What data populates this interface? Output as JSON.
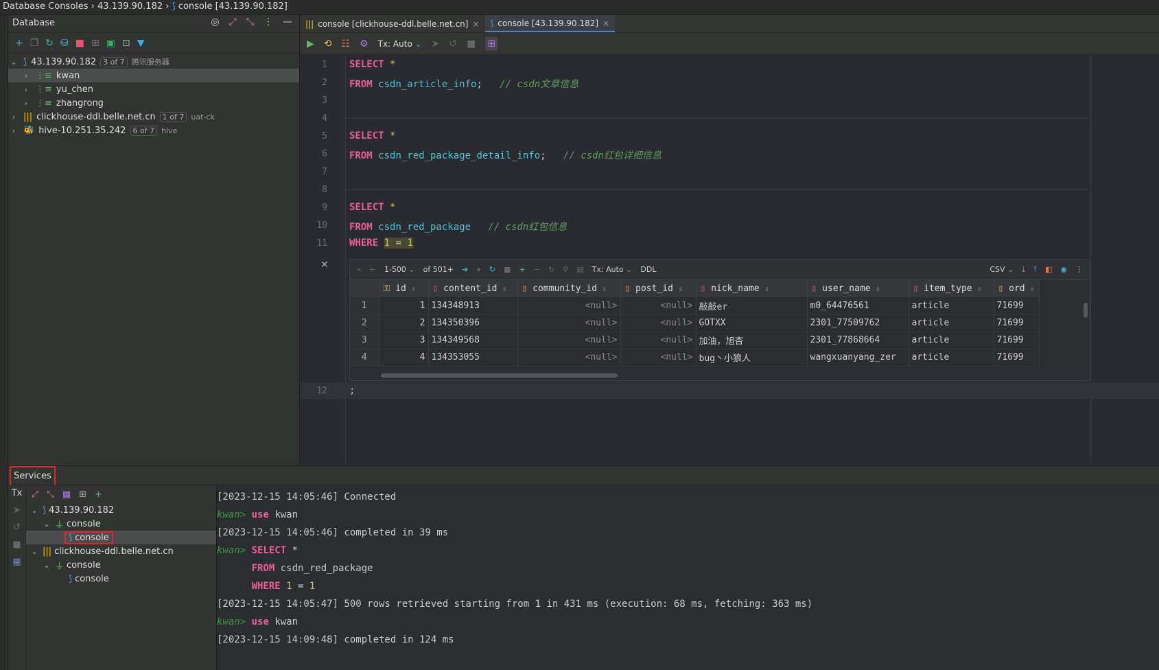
{
  "titlebar": {
    "crumbs": [
      "Database Consoles",
      "43.139.90.182",
      "console [43.139.90.182]"
    ]
  },
  "db_panel": {
    "title": "Database",
    "tree": [
      {
        "label": "43.139.90.182",
        "badge": "3 of 7",
        "hint": "腾讯服务器",
        "children": [
          "kwan",
          "yu_chen",
          "zhangrong"
        ]
      },
      {
        "label": "clickhouse-ddl.belle.net.cn",
        "badge": "1 of 7",
        "hint": "uat-ck"
      },
      {
        "label": "hive-10.251.35.242",
        "badge": "6 of 7",
        "hint": "hive"
      }
    ]
  },
  "editor": {
    "tabs": [
      {
        "label": "console [clickhouse-ddl.belle.net.cn]"
      },
      {
        "label": "console [43.139.90.182]",
        "active": true
      }
    ],
    "toolbar": {
      "tx": "Tx: Auto"
    },
    "lines": [
      {
        "n": "1",
        "kw": "SELECT",
        "rest": " *"
      },
      {
        "n": "2",
        "kw": "FROM",
        "table": "csdn_article_info",
        "semi": ";",
        "comment": "// csdn文章信息"
      },
      {
        "n": "3"
      },
      {
        "n": "4"
      },
      {
        "n": "5",
        "kw": "SELECT",
        "rest": " *"
      },
      {
        "n": "6",
        "kw": "FROM",
        "table": "csdn_red_package_detail_info",
        "semi": ";",
        "comment": "// csdn红包详细信息"
      },
      {
        "n": "7"
      },
      {
        "n": "8"
      },
      {
        "n": "9",
        "kw": "SELECT",
        "rest": " *"
      },
      {
        "n": "10",
        "kw": "FROM",
        "table": "csdn_red_package",
        "semi": "",
        "comment": "// csdn红包信息"
      },
      {
        "n": "11",
        "kw": "WHERE",
        "a": "1",
        "op": " = ",
        "b": "1"
      },
      {
        "n": "12",
        "rest": ";"
      }
    ]
  },
  "grid": {
    "toolbar": {
      "range": "1-500",
      "of": "of 501+",
      "tx": "Tx: Auto",
      "ddl": "DDL",
      "export": "CSV"
    },
    "columns": [
      "id",
      "content_id",
      "community_id",
      "post_id",
      "nick_name",
      "user_name",
      "item_type",
      "ord"
    ],
    "rows": [
      [
        "1",
        "1",
        "134348913",
        "<null>",
        "<null>",
        "敲敲er",
        "m0_64476561",
        "article",
        "71699"
      ],
      [
        "2",
        "2",
        "134350396",
        "<null>",
        "<null>",
        "GOTXX",
        "2301_77509762",
        "article",
        "71699"
      ],
      [
        "3",
        "3",
        "134349568",
        "<null>",
        "<null>",
        "加油，旭杏",
        "2301_77868664",
        "article",
        "71699"
      ],
      [
        "4",
        "4",
        "134353055",
        "<null>",
        "<null>",
        "bug丶小狼人",
        "wangxuanyang_zer",
        "article",
        "71699"
      ]
    ]
  },
  "services": {
    "title": "Services",
    "tx": "Tx",
    "tree": [
      {
        "label": "43.139.90.182",
        "child": "console",
        "leaf": "console"
      },
      {
        "label": "clickhouse-ddl.belle.net.cn",
        "child": "console",
        "leaf": "console"
      }
    ],
    "output": {
      "l1": "[2023-12-15 14:05:46] Connected",
      "prompt": "kwan>",
      "use": "use",
      "db": "kwan",
      "l3": "[2023-12-15 14:05:46] completed in 39 ms",
      "sel": "SELECT",
      "star": "*",
      "from": "FROM",
      "tbl": "csdn_red_package",
      "where": "WHERE",
      "one": "1",
      "eq": "=",
      "l7": "[2023-12-15 14:05:47] 500 rows retrieved starting from 1 in 431 ms (execution: 68 ms, fetching: 363 ms)",
      "l9": "[2023-12-15 14:09:48] completed in 124 ms"
    }
  }
}
